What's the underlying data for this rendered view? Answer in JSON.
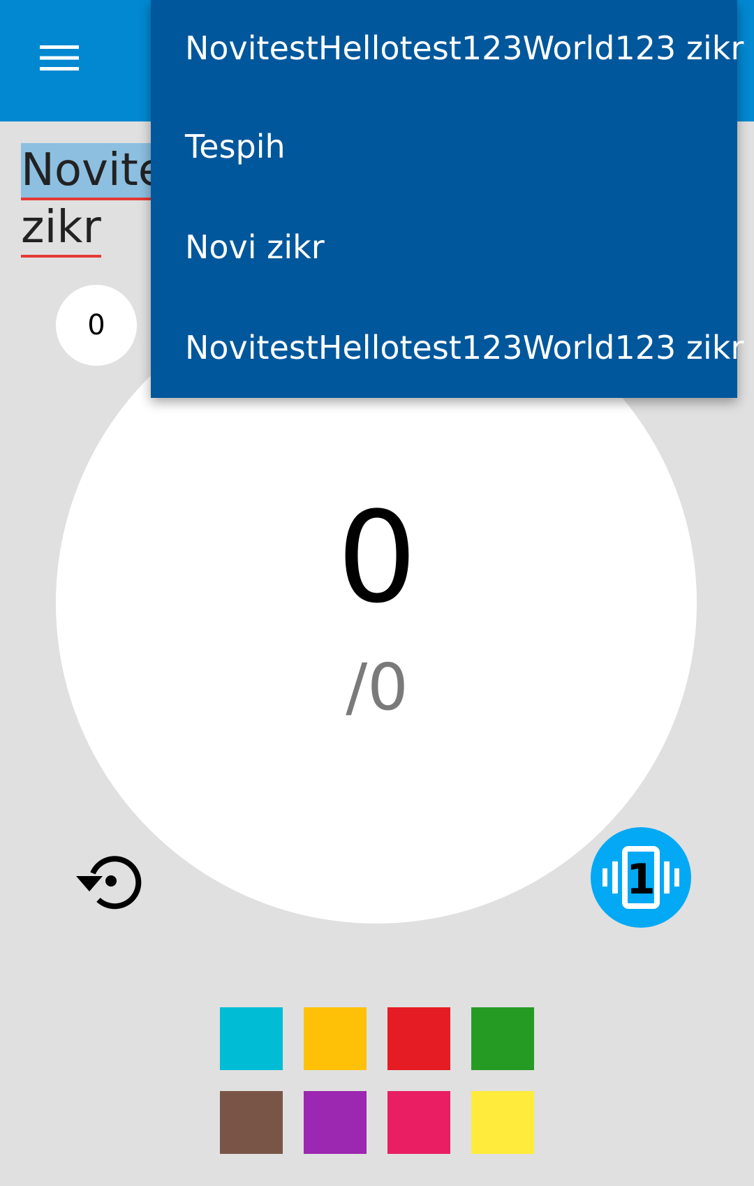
{
  "app_bar": {
    "menu_icon": "hamburger-menu-icon",
    "color": "#0288d1"
  },
  "title": {
    "line1": "Novite",
    "line2": "zikr"
  },
  "small_counter": {
    "value": "0"
  },
  "counter": {
    "value": "0",
    "target": "/0"
  },
  "reset_icon": "restore-icon",
  "vibrate": {
    "icon": "vibration-icon",
    "label": "1",
    "color": "#03a9f4"
  },
  "dropdown": {
    "color": "#01579b",
    "items": [
      "NovitestHellotest123World123 zikr",
      "Tespih",
      "Novi zikr",
      "NovitestHellotest123World123 zikr"
    ]
  },
  "swatches": [
    "#00bcd4",
    "#ffc107",
    "#e51c23",
    "#259b24",
    "#795548",
    "#9c27b0",
    "#e91e63",
    "#ffeb3b"
  ]
}
